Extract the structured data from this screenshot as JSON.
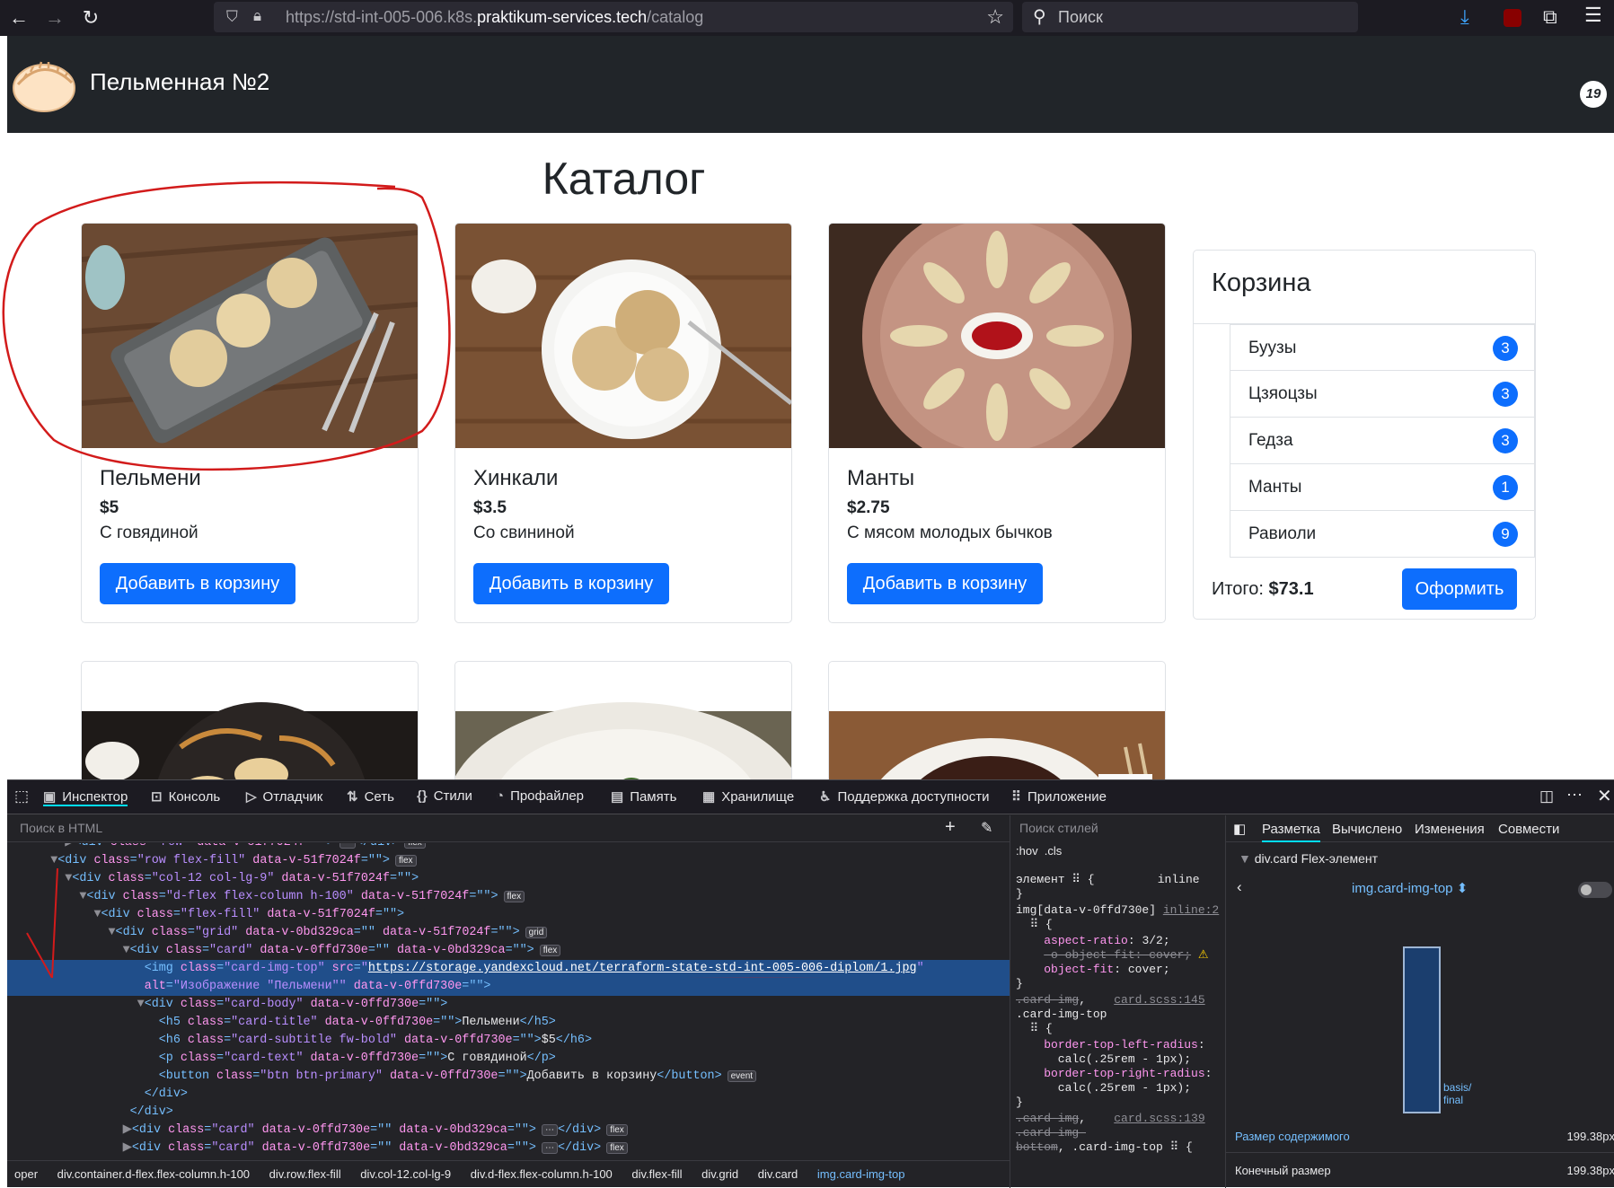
{
  "browser": {
    "url": "https://std-int-005-006.k8s.praktikum-services.tech/catalog",
    "url_prefix": "https://std-int-005-006.k8s.",
    "url_host": "praktikum-services.tech",
    "url_path": "/catalog",
    "search_placeholder": "Поиск"
  },
  "navbar": {
    "brand": "Пельменная №2",
    "cart_count": "19"
  },
  "page": {
    "title": "Каталог"
  },
  "products": [
    {
      "title": "Пельмени",
      "price": "$5",
      "text": "С говядиной",
      "button": "Добавить в корзину"
    },
    {
      "title": "Хинкали",
      "price": "$3.5",
      "text": "Со свининой",
      "button": "Добавить в корзину"
    },
    {
      "title": "Манты",
      "price": "$2.75",
      "text": "С мясом молодых бычков",
      "button": "Добавить в корзину"
    }
  ],
  "basket": {
    "title": "Корзина",
    "items": [
      {
        "label": "Буузы",
        "count": "3"
      },
      {
        "label": "Цзяоцзы",
        "count": "3"
      },
      {
        "label": "Гедза",
        "count": "3"
      },
      {
        "label": "Манты",
        "count": "1"
      },
      {
        "label": "Равиоли",
        "count": "9"
      }
    ],
    "total_label": "Итого:",
    "total_value": "$73.1",
    "checkout": "Оформить"
  },
  "devtools": {
    "tabs": [
      "Инспектор",
      "Консоль",
      "Отладчик",
      "Сеть",
      "Стили",
      "Профайлер",
      "Память",
      "Хранилище",
      "Поддержка доступности",
      "Приложение"
    ],
    "html_search_placeholder": "Поиск в HTML",
    "styles_search_placeholder": "Поиск стилей",
    "styles_toggles": ":hov  .cls",
    "layout_tabs": [
      "Разметка",
      "Вычислено",
      "Изменения",
      "Совмести"
    ],
    "flex_item_title": "div.card Flex-элемент",
    "flex_item_selector": "img.card-img-top",
    "flex_basis_label": "basis/ final",
    "content_size_label": "Размер содержимого",
    "content_size_value": "199.38px",
    "final_size_label": "Конечный размер",
    "final_size_value": "199.38px",
    "breadcrumbs": [
      "oper",
      "div.container.d-flex.flex-column.h-100",
      "div.row.flex-fill",
      "div.col-12.col-lg-9",
      "div.d-flex.flex-column.h-100",
      "div.flex-fill",
      "div.grid",
      "div.card",
      "img.card-img-top"
    ],
    "selected_src": "https://storage.yandexcloud.net/terraform-state-std-int-005-006-diplom/1.jpg"
  }
}
